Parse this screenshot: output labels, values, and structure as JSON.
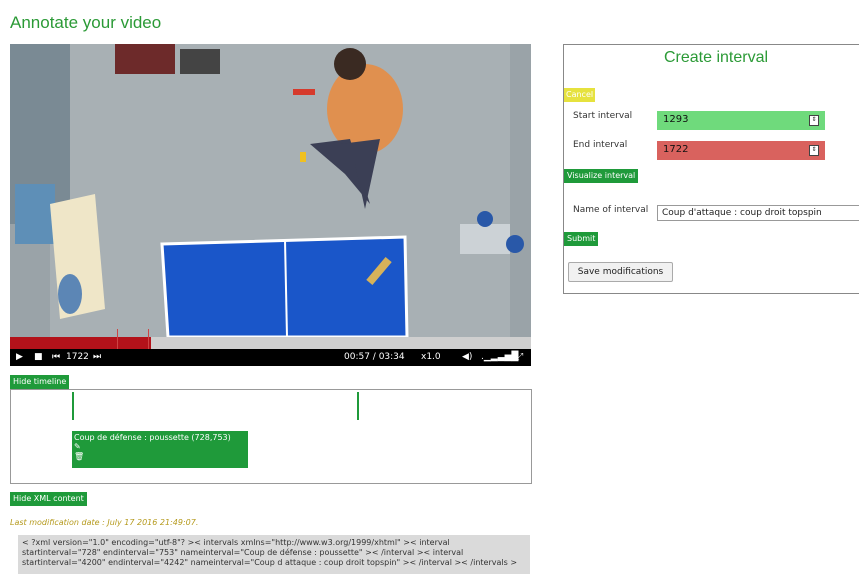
{
  "page_title": "Annotate your video",
  "video": {
    "progress_fraction": 0.27,
    "frame": "1722",
    "time": "00:57 / 03:34",
    "speed": "x1.0"
  },
  "buttons": {
    "hide_timeline": "Hide timeline",
    "hide_xml": "Hide XML content"
  },
  "timeline": {
    "interval_label": "Coup de défense : poussette (728,753)"
  },
  "last_modification": "Last modification date : July 17 2016 21:49:07.",
  "xml_content": "< ?xml version=\"1.0\" encoding=\"utf-8\"? >< intervals xmlns=\"http://www.w3.org/1999/xhtml\" >< interval startinterval=\"728\" endinterval=\"753\" nameinterval=\"Coup de défense : poussette\" >< /interval >< interval startinterval=\"4200\" endinterval=\"4242\" nameinterval=\"Coup d attaque : coup droit topspin\" >< /interval >< /intervals >",
  "panel": {
    "title": "Create interval",
    "cancel": "Cancel",
    "start_label": "Start interval",
    "start_value": "1293",
    "end_label": "End interval",
    "end_value": "1722",
    "visualize": "Visualize interval",
    "name_label": "Name of interval",
    "name_value": "Coup d'attaque : coup droit topspin",
    "submit": "Submit",
    "save": "Save modifications"
  },
  "colors": {
    "accent_green": "#2b9a36",
    "button_green": "#1f9a3a",
    "start_field": "#6fda7c",
    "end_field": "#d9625e",
    "cancel_yellow": "#e6e23e",
    "progress_red": "#b3121a"
  },
  "icons": [
    "play-icon",
    "stop-icon",
    "step-back-icon",
    "step-forward-icon",
    "volume-icon",
    "fullscreen-icon",
    "pencil-icon",
    "trash-icon",
    "spinner-icon"
  ]
}
